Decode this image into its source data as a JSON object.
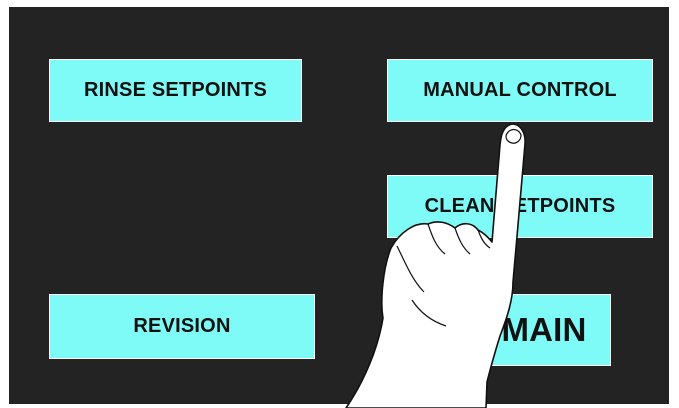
{
  "panel": {
    "background": "#232323",
    "button_color": "#7ffbf7"
  },
  "buttons": {
    "rinse_setpoints": "RINSE SETPOINTS",
    "manual_control": "MANUAL CONTROL",
    "clean_setpoints": "CLEAN SETPOINTS",
    "revision": "REVISION",
    "main": "MAIN"
  },
  "overlay": {
    "icon": "pointing-hand-icon"
  }
}
